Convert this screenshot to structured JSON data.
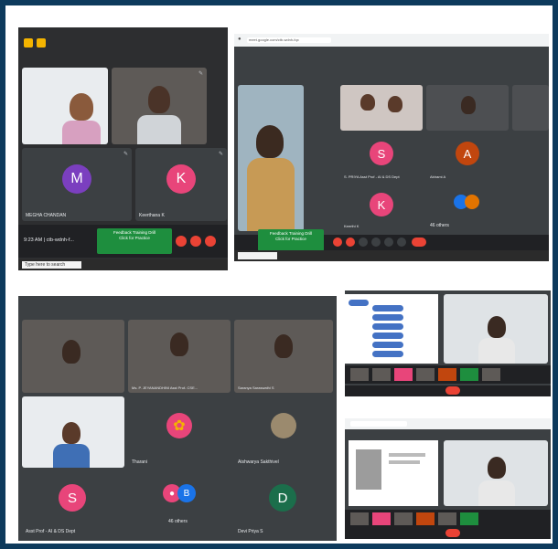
{
  "colors": {
    "page_border": "#0d3a5c",
    "meet_bg": "#3c4043",
    "tile_bg": "#202124",
    "end_call": "#ea4335",
    "banner": "#1e8e3e"
  },
  "meet1": {
    "participants": [
      {
        "initial": "M",
        "name": "MEGHA CHANDAN",
        "color": "#7b3fbf"
      },
      {
        "initial": "K",
        "name": "Keerthana K",
        "color": "#e8457a"
      }
    ],
    "time_label": "9:23 AM  |  ctb-wdnh-f...",
    "banner_text": "Feedback Training Drill\nClick for Practice"
  },
  "meet2": {
    "url": "meet.google.com/ctb-wdnh-fqx",
    "participants": [
      {
        "initial": "S",
        "name": "S. PRIYA Asst Prof - AI & DS Dept",
        "color": "#e8457a"
      },
      {
        "initial": "A",
        "name": "Abirami A",
        "color": "#c1460e"
      },
      {
        "initial": "K",
        "name": "Keerthi K",
        "color": "#e8457a"
      }
    ],
    "others_label": "46 others",
    "banner_text": "Feedback Training Drill\nClick for Practice"
  },
  "meet3": {
    "participants": [
      {
        "name": "Ms. P. JEYANANDHINI Asst Prof- CSE...",
        "type": "video"
      },
      {
        "name": "Saranya Saraswathi S",
        "type": "video"
      },
      {
        "name": "Tharani",
        "type": "sunflower"
      },
      {
        "name": "Aishwarya Sakthivel",
        "type": "photo"
      },
      {
        "initial": "S",
        "name": "Asst Prof - AI & DS Dept",
        "color": "#e8457a"
      },
      {
        "initial": "D",
        "name": "Devi Priya S",
        "color": "#1b6e4b"
      }
    ],
    "others_label": "46 others",
    "others_initial": "B"
  },
  "meet4": {},
  "meet5": {},
  "search_placeholder": "Type here to search"
}
